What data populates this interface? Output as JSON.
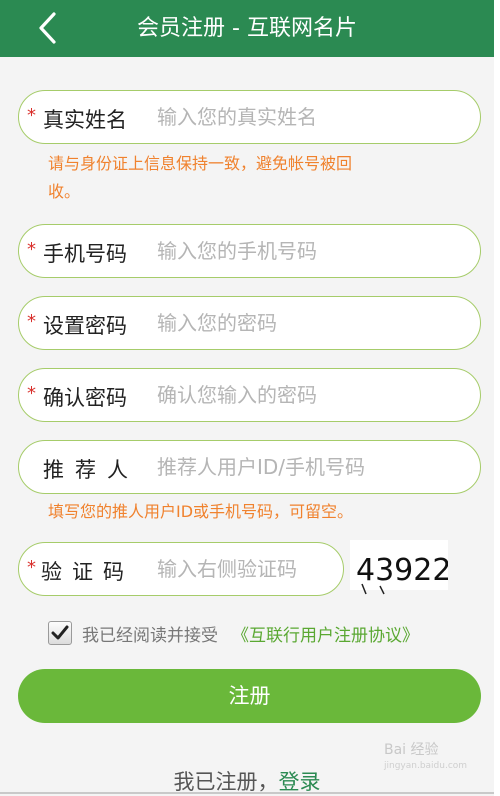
{
  "header": {
    "title": "会员注册 - 互联网名片"
  },
  "form": {
    "fields": [
      {
        "label": "真实姓名",
        "placeholder": "输入您的真实姓名",
        "required_mark": "*"
      },
      {
        "label": "手机号码",
        "placeholder": "输入您的手机号码",
        "required_mark": "*"
      },
      {
        "label": "设置密码",
        "placeholder": "输入您的密码",
        "required_mark": "*"
      },
      {
        "label": "确认密码",
        "placeholder": "确认您输入的密码",
        "required_mark": "*"
      },
      {
        "label": "推荐人",
        "placeholder": "推荐人用户ID/手机号码"
      },
      {
        "label": "验证码",
        "placeholder": "输入右侧验证码",
        "required_mark": "*"
      }
    ],
    "name_hint_line1": "请与身份证上信息保持一致，避免帐号被回",
    "name_hint_line2": "收。",
    "referrer_hint": "填写您的推人用户ID或手机号码，可留空。",
    "captcha_code": "43922",
    "agree_checked": true,
    "agree_text": "我已经阅读并接受",
    "agreement_link": "《互联行用户注册协议》",
    "submit_label": "注册",
    "login_prompt": "我已注册，",
    "login_link": "登录"
  },
  "watermark": {
    "brand": "Bai 经验",
    "sub": "jingyan.baidu.com"
  },
  "colors": {
    "header": "#2b8a52",
    "field_border": "#a6cc6a",
    "required": "#d9302c",
    "hint": "#f0822e",
    "link": "#5aa832",
    "submit": "#6ab83a"
  },
  "icons": {
    "back": "chevron-left-icon",
    "checkbox": "check-icon"
  }
}
